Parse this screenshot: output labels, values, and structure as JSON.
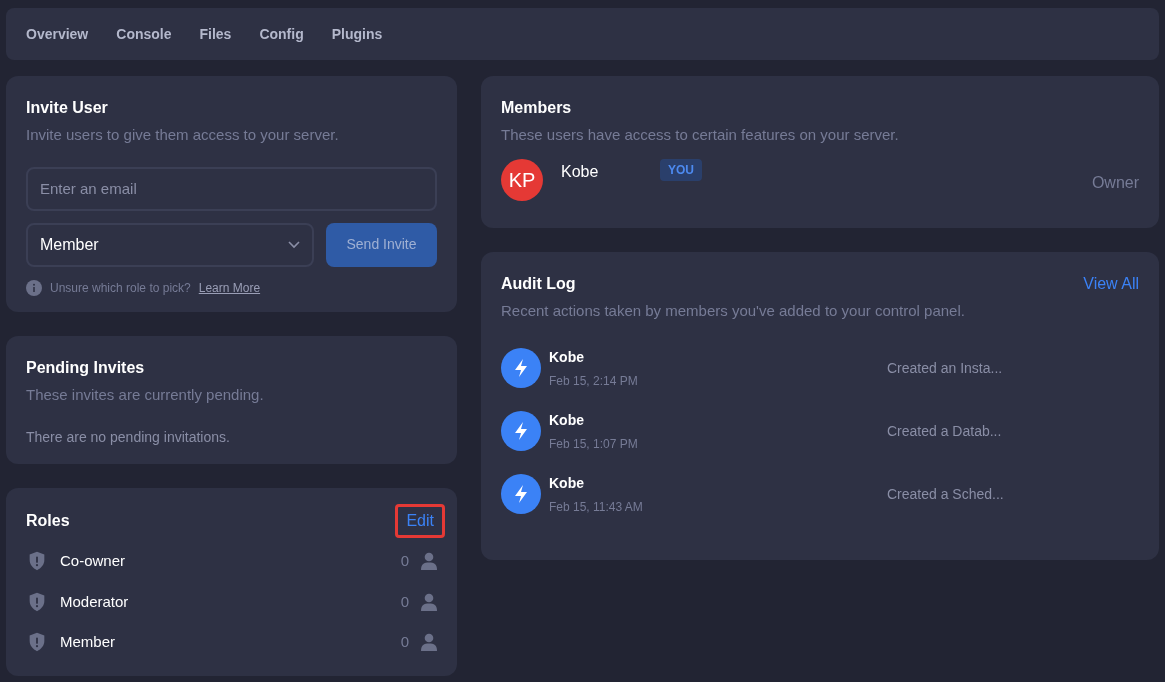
{
  "nav": [
    {
      "label": "Overview",
      "selected": false
    },
    {
      "label": "Console",
      "selected": false
    },
    {
      "label": "Files",
      "selected": false
    },
    {
      "label": "Config",
      "selected": false
    },
    {
      "label": "Plugins",
      "selected": false
    }
  ],
  "invite": {
    "title": "Invite User",
    "subtitle": "Invite users to give them access to your server.",
    "email": {
      "placeholder": "Enter an email"
    },
    "role": "Member",
    "button": "Send Invite",
    "hint": "Unsure which role to pick?",
    "link": "Learn More"
  },
  "pending": {
    "title": "Pending Invites",
    "subtitle": "These invites are currently pending.",
    "empty": "There are no pending invitations."
  },
  "roles": {
    "title": "Roles",
    "edit": {
      "label": "Edit",
      "highlighted": true
    },
    "items": [
      {
        "name": "Co-owner",
        "count": "0"
      },
      {
        "name": "Moderator",
        "count": "0"
      },
      {
        "name": "Member",
        "count": "0"
      }
    ]
  },
  "members": {
    "title": "Members",
    "subtitle": "These users have access to certain features on your server.",
    "items": [
      {
        "initials": "KP",
        "color": "#e53935",
        "name": "Kobe",
        "badge": "YOU",
        "role": "Owner"
      }
    ]
  },
  "audit": {
    "title": "Audit Log",
    "view_all": "View All",
    "subtitle": "Recent actions taken by members you've added to your control panel.",
    "items": [
      {
        "name": "Kobe",
        "time": "Feb 15, 2:14 PM",
        "action": "Created an Insta..."
      },
      {
        "name": "Kobe",
        "time": "Feb 15, 1:07 PM",
        "action": "Created a Datab..."
      },
      {
        "name": "Kobe",
        "time": "Feb 15, 11:43 AM",
        "action": "Created a Sched..."
      }
    ]
  }
}
